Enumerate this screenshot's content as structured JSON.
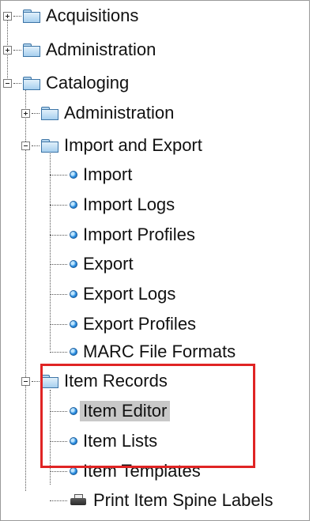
{
  "tree": {
    "acquisitions": "Acquisitions",
    "administration": "Administration",
    "cataloging": "Cataloging",
    "cataloging_children": {
      "administration": "Administration",
      "import_export": "Import and Export",
      "import_export_children": [
        "Import",
        "Import Logs",
        "Import Profiles",
        "Export",
        "Export Logs",
        "Export Profiles",
        "MARC File Formats"
      ],
      "item_records": "Item Records",
      "item_records_children": [
        "Item Editor",
        "Item Lists",
        "Item Templates"
      ],
      "print_spine_labels": "Print Item Spine Labels"
    }
  },
  "selected_item": "Item Editor",
  "colors": {
    "highlight_box": "#e02424",
    "selection_bg": "#c8c8c8",
    "folder_blue": "#3c74a6",
    "leaf_blue": "#2b8ee0"
  },
  "icons": {
    "folder": "folder-icon",
    "leaf": "leaf-node-icon",
    "printer": "printer-icon",
    "expand": "expand-icon",
    "collapse": "collapse-icon"
  }
}
